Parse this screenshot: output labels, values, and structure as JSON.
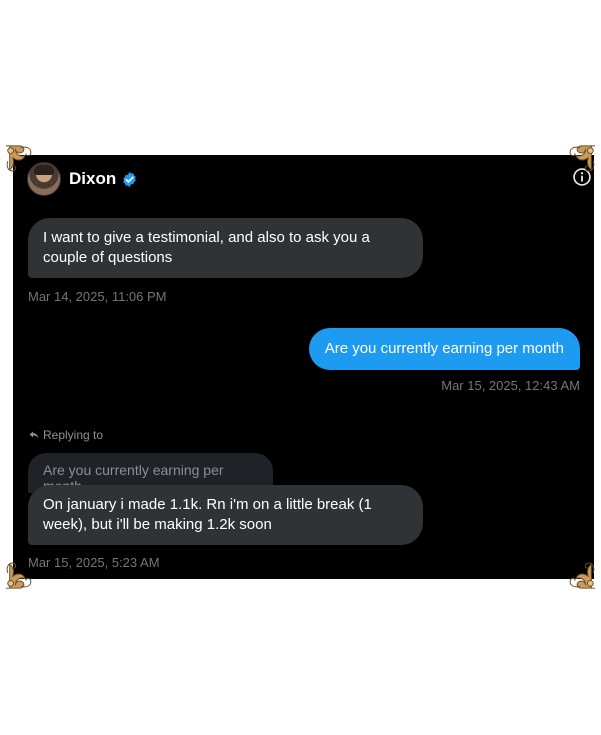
{
  "contact": {
    "name": "Dixon"
  },
  "messages": [
    {
      "direction": "incoming",
      "text": "I want to give a testimonial, and also to ask you a couple of questions",
      "timestamp": "Mar 14, 2025, 11:06 PM"
    },
    {
      "direction": "outgoing",
      "text": "Are you currently earning per month",
      "timestamp": "Mar 15, 2025, 12:43 AM"
    },
    {
      "direction": "incoming",
      "reply_label": "Replying to",
      "quoted_text": "Are you currently earning per month",
      "text": "On january i made 1.1k. Rn i'm on a little break (1 week), but i'll be making 1.2k soon",
      "timestamp": "Mar 15, 2025, 5:23 AM"
    }
  ],
  "colors": {
    "background": "#000000",
    "incoming_bubble": "#2f3336",
    "outgoing_bubble": "#1d9bf0",
    "timestamp": "#71767b",
    "verified_badge": "#1d9bf0",
    "corner_ornament": "#c89a5e"
  },
  "icons": {
    "verified": "verified-badge-icon",
    "info": "info-icon",
    "reply": "reply-arrow-icon",
    "ornament": "baroque-corner-ornament"
  }
}
